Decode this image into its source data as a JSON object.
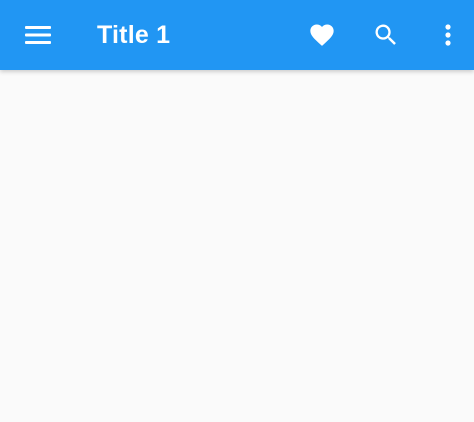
{
  "colors": {
    "app_bar": "#2196f3",
    "app_bar_text": "#ffffff",
    "background": "#fafafa"
  },
  "app_bar": {
    "title": "Title 1",
    "leading_icon": "menu-icon",
    "actions": [
      {
        "icon": "favorite-icon"
      },
      {
        "icon": "search-icon"
      },
      {
        "icon": "more-vert-icon"
      }
    ]
  }
}
